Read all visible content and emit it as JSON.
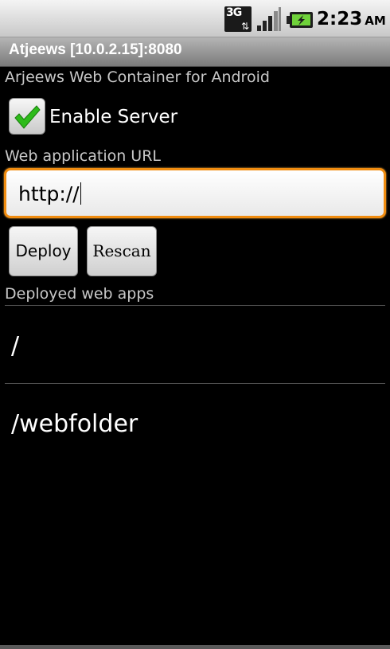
{
  "status_bar": {
    "network_label": "3G",
    "network_icon": "3g-data-icon",
    "signal_icon": "signal-strength-icon",
    "battery_icon": "battery-charging-icon",
    "time": "2:23",
    "ampm": "AM"
  },
  "title_bar": {
    "title": "Atjeews [10.0.2.15]:8080"
  },
  "main": {
    "subtitle": "Arjeews Web Container for Android",
    "enable_server": {
      "label": "Enable Server",
      "checked": true
    },
    "url_label": "Web application URL",
    "url_input": {
      "value": "http://"
    },
    "buttons": {
      "deploy": "Deploy",
      "rescan": "Rescan"
    },
    "deployed_label": "Deployed web apps",
    "deployed_apps": [
      "/",
      "/webfolder"
    ]
  },
  "colors": {
    "accent_focus": "#f08c10",
    "check_green": "#2dbb1a"
  }
}
